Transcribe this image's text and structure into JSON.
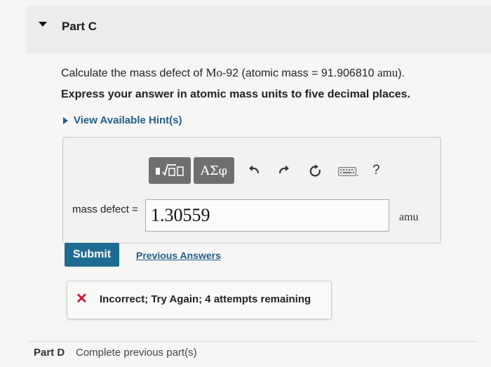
{
  "part_c": {
    "title": "Part C"
  },
  "question": {
    "prefix": "Calculate the mass defect of ",
    "isotope": "Mo",
    "isotope_suffix": "-92 (atomic mass = 91.906810 ",
    "unit": "amu",
    "end": ").",
    "instruction": "Express your answer in atomic mass units to five decimal places."
  },
  "hint": {
    "label": "View Available Hint(s)"
  },
  "toolbar": {
    "templates_icon": "templates-sqrt-icon",
    "symbols_label": "ΑΣφ",
    "undo_icon": "undo-icon",
    "redo_icon": "redo-icon",
    "reset_icon": "reset-icon",
    "keyboard_icon": "keyboard-icon",
    "help_label": "?"
  },
  "answer": {
    "label": "mass defect =",
    "value": "1.30559",
    "unit": "amu"
  },
  "actions": {
    "submit_label": "Submit",
    "previous_answers_label": "Previous Answers"
  },
  "feedback": {
    "icon": "x-icon",
    "message": "Incorrect; Try Again; 4 attempts remaining",
    "color": "#c8102e"
  },
  "part_d": {
    "label": "Part D",
    "status": "Complete previous part(s)"
  }
}
